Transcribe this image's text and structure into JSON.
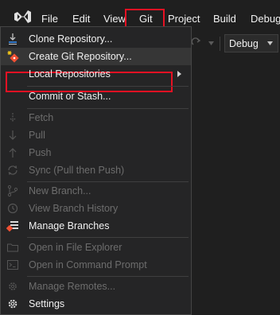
{
  "menubar": {
    "logo_icon": "visual-studio-logo-icon",
    "items": [
      "File",
      "Edit",
      "View",
      "Git",
      "Project",
      "Build",
      "Debug"
    ]
  },
  "toolbar": {
    "configuration": "Debug"
  },
  "git_menu": {
    "items": [
      {
        "label": "Clone Repository...",
        "icon": "clone-icon",
        "enabled": true
      },
      {
        "label": "Create Git Repository...",
        "icon": "create-repository-icon",
        "enabled": true
      },
      {
        "label": "Local Repositories",
        "icon": "",
        "enabled": true,
        "submenu": true
      },
      {
        "label": "Commit or Stash...",
        "icon": "",
        "enabled": true
      },
      {
        "label": "Fetch",
        "icon": "fetch-icon",
        "enabled": false
      },
      {
        "label": "Pull",
        "icon": "pull-icon",
        "enabled": false
      },
      {
        "label": "Push",
        "icon": "push-icon",
        "enabled": false
      },
      {
        "label": "Sync (Pull then Push)",
        "icon": "sync-icon",
        "enabled": false
      },
      {
        "label": "New Branch...",
        "icon": "new-branch-icon",
        "enabled": false
      },
      {
        "label": "View Branch History",
        "icon": "history-icon",
        "enabled": false
      },
      {
        "label": "Manage Branches",
        "icon": "manage-branches-icon",
        "enabled": true
      },
      {
        "label": "Open in File Explorer",
        "icon": "folder-icon",
        "enabled": false
      },
      {
        "label": "Open in Command Prompt",
        "icon": "terminal-icon",
        "enabled": false
      },
      {
        "label": "Manage Remotes...",
        "icon": "remotes-gear-icon",
        "enabled": false
      },
      {
        "label": "Settings",
        "icon": "settings-gear-icon",
        "enabled": true
      }
    ]
  },
  "colors": {
    "highlight": "#e81123",
    "git_orange": "#f05033",
    "menu_bg": "#252526",
    "disabled_text": "#6d6d6d"
  }
}
